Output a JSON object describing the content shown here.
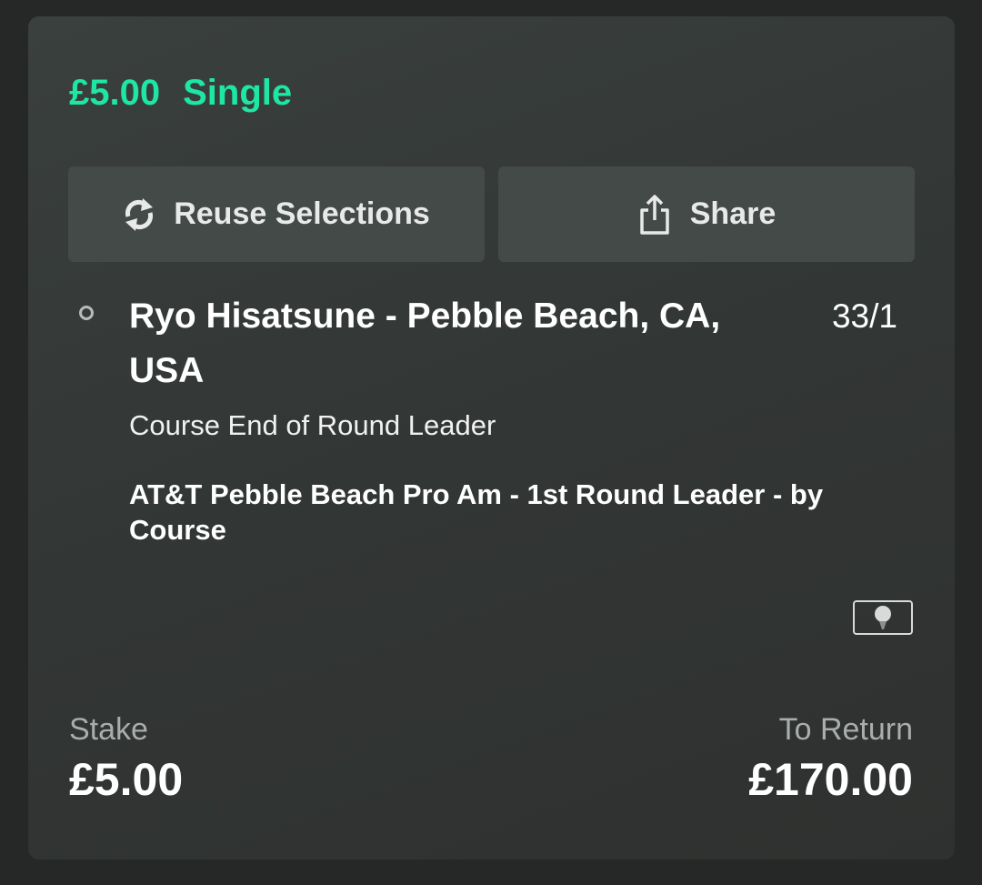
{
  "bet": {
    "stake_label": "£5.00",
    "type_label": "Single"
  },
  "actions": {
    "reuse_label": "Reuse Selections",
    "reuse_icon": "refresh-icon",
    "share_label": "Share",
    "share_icon": "share-icon"
  },
  "selection": {
    "name": "Ryo Hisatsune - Pebble Beach, CA, USA",
    "odds": "33/1",
    "market": "Course End of Round Leader",
    "event": "AT&T Pebble Beach Pro Am - 1st Round Leader - by Course",
    "sport_icon": "golf-ball-icon"
  },
  "summary": {
    "stake_label": "Stake",
    "stake_value": "£5.00",
    "return_label": "To Return",
    "return_value": "£170.00"
  },
  "colors": {
    "accent": "#1ee6a4",
    "card_bg": "#343837",
    "page_bg": "#262827",
    "button_bg": "#444a48"
  }
}
